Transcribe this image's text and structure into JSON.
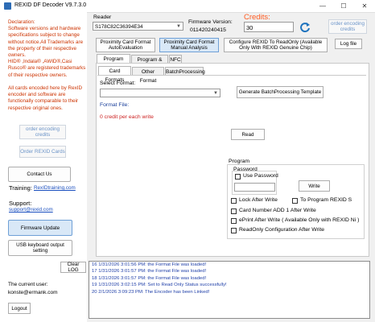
{
  "window": {
    "title": "REXID DF Decoder V9.7.3.0",
    "minimize": "—",
    "maximize": "☐",
    "close": "✕"
  },
  "left": {
    "disclaimer": "Declaration:\nSoftware versions and hardware specifications subject to change without notice.All Trademarks are the property of their respective owners.\nHID® ,Indala® ,AWID®,Casi Rusco® are registered trademarks of  their respective owners.\n\nAll cards encoded here by RexID encoder and software are  functionally comparable to their respective original ones.",
    "order_encoding_credits": "order encoding credits",
    "order_rexid_cards": "Order REXID Cards",
    "contact_us": "Contact Us",
    "training_label": "Training:",
    "training_link": "RexIDtraining.com",
    "support_label": "Support:",
    "support_email": "support@rexid.com",
    "firmware_update": "Firmware Update",
    "usb_keyboard": "USB keyboard output setting",
    "current_user_label": "The current user:",
    "current_user": "konste@ermank.com",
    "logout": "Logout"
  },
  "header": {
    "reader_label": "Reader",
    "reader_value": "S178C82C36394E34",
    "firmware_label": "Firmware Version:",
    "firmware_value": "011420240415",
    "credits_label": "Credits:",
    "credits_value": "30",
    "order_encoding_credits": "order encoding credits",
    "prox_auto": "Proximity Card Format AutoEvaluation",
    "prox_manual": "Proximity Card Format Manual Analysis",
    "configure_readonly": "Configure REXID To ReadOnly (Available Only With REXID Genuine Chip)",
    "log_file": "Log file"
  },
  "tabs": {
    "main": [
      "Program Only",
      "Program & Print",
      "NFC"
    ],
    "sub": [
      "Card Formats",
      "Other Format",
      "BatchProcessing"
    ]
  },
  "card_formats": {
    "select_label": "Select Format:",
    "select_value": "",
    "generate_batch": "Generate BatchProcessing Template",
    "format_file_label": "Format File:",
    "credit_per_write": "0 credit per each write",
    "read": "Read"
  },
  "program": {
    "group_label": "Program",
    "password_label": "Password",
    "use_password": "Use Password",
    "write": "Write",
    "lock_after_write": "Lock After Write",
    "to_program_rexid": "To Program REXID S",
    "card_number_add": "Card Number ADD 1 After Write",
    "eprint_after_write": "ePrint After Write ( Available Only with REXID Ni )",
    "readonly_config": "ReadOnly Configuration After Write"
  },
  "log": {
    "clear_log": "Clear LOG",
    "lines": [
      "16  1/31/2026 3:01:56 PM: the Format File was loaded!",
      "17  1/31/2026 3:01:57 PM: the Format File was loaded!",
      "18  1/31/2026 3:01:57 PM: the Format File was loaded!",
      "19  1/31/2026 3:02:15 PM: Set to Read Only Status successfully!",
      "20  2/1/2026 3:09:23 PM: The Encoder has been Linked!"
    ]
  }
}
